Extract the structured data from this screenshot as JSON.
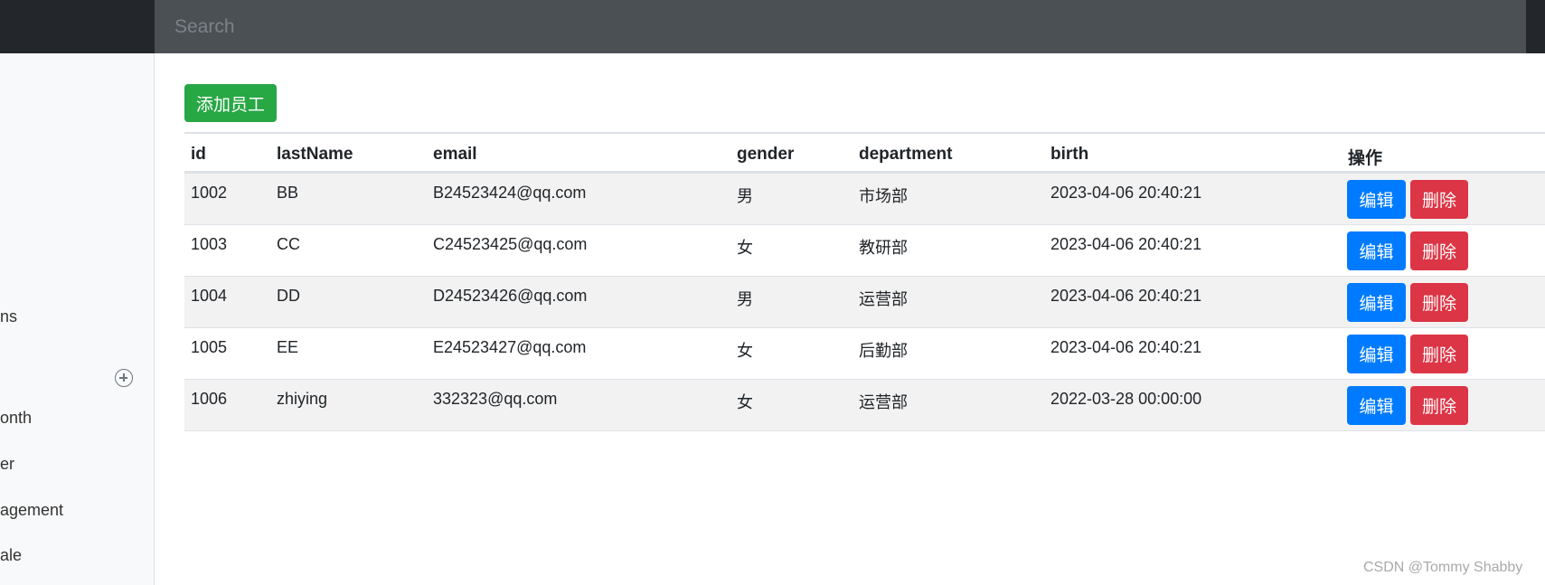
{
  "search": {
    "placeholder": "Search"
  },
  "sidebar": {
    "items": [
      {
        "label": "ns"
      },
      {
        "label": "onth"
      },
      {
        "label": "er"
      },
      {
        "label": "agement"
      },
      {
        "label": "ale"
      }
    ],
    "add_icon": "plus-circle-icon"
  },
  "toolbar": {
    "add_label": "添加员工"
  },
  "table": {
    "headers": [
      "id",
      "lastName",
      "email",
      "gender",
      "department",
      "birth",
      "操作"
    ],
    "rows": [
      {
        "id": "1002",
        "lastName": "BB",
        "email": "B24523424@qq.com",
        "gender": "男",
        "department": "市场部",
        "birth": "2023-04-06 20:40:21"
      },
      {
        "id": "1003",
        "lastName": "CC",
        "email": "C24523425@qq.com",
        "gender": "女",
        "department": "教研部",
        "birth": "2023-04-06 20:40:21"
      },
      {
        "id": "1004",
        "lastName": "DD",
        "email": "D24523426@qq.com",
        "gender": "男",
        "department": "运营部",
        "birth": "2023-04-06 20:40:21"
      },
      {
        "id": "1005",
        "lastName": "EE",
        "email": "E24523427@qq.com",
        "gender": "女",
        "department": "后勤部",
        "birth": "2023-04-06 20:40:21"
      },
      {
        "id": "1006",
        "lastName": "zhiying",
        "email": "332323@qq.com",
        "gender": "女",
        "department": "运营部",
        "birth": "2022-03-28 00:00:00"
      }
    ],
    "edit_label": "编辑",
    "delete_label": "删除"
  },
  "watermark": "CSDN @Tommy Shabby",
  "colors": {
    "primary": "#007bff",
    "success": "#28a745",
    "danger": "#dc3545",
    "topbar": "#4b5055"
  }
}
